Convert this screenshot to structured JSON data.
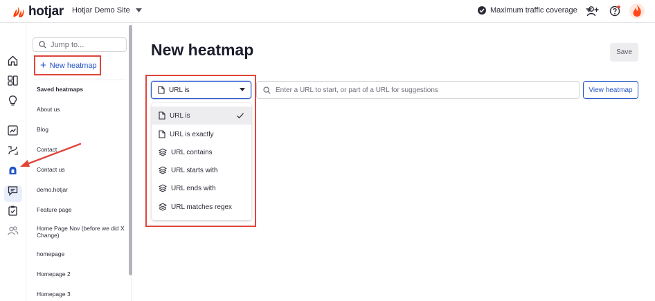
{
  "topbar": {
    "brand": "hotjar",
    "site_name": "Hotjar Demo Site",
    "traffic_label": "Maximum traffic coverage",
    "icons": [
      "hotjar-logo-icon",
      "chevron-down-icon",
      "check-circle-icon",
      "add-user-icon",
      "help-icon",
      "flame-avatar-icon"
    ]
  },
  "rail": {
    "icons": [
      "home-icon",
      "dashboards-icon",
      "lightbulb-icon",
      "trends-icon",
      "recordings-icon",
      "heatmaps-icon",
      "feedback-icon",
      "surveys-icon",
      "users-icon"
    ],
    "active": "heatmaps-icon"
  },
  "sidebar": {
    "search_placeholder": "Jump to...",
    "new_heatmap_label": "New heatmap",
    "saved_title": "Saved heatmaps",
    "items": [
      "About us",
      "Blog",
      "Contact",
      "Contact us",
      "demo.hotjar",
      "Feature page",
      "Home Page Nov (before we did X Change)",
      "homepage",
      "Homepage 2",
      "Homepage 3"
    ]
  },
  "main": {
    "title": "New heatmap",
    "save_label": "Save",
    "filter_selected": "URL is",
    "url_placeholder": "Enter a URL to start, or part of a URL for suggestions",
    "view_label": "View heatmap",
    "menu_items": [
      {
        "label": "URL is",
        "icon": "page-icon",
        "selected": true
      },
      {
        "label": "URL is exactly",
        "icon": "page-icon",
        "selected": false
      },
      {
        "label": "URL contains",
        "icon": "layers-icon",
        "selected": false
      },
      {
        "label": "URL starts with",
        "icon": "layers-icon",
        "selected": false
      },
      {
        "label": "URL ends with",
        "icon": "layers-icon",
        "selected": false
      },
      {
        "label": "URL matches regex",
        "icon": "layers-icon",
        "selected": false
      }
    ]
  },
  "colors": {
    "accent": "#2253c7",
    "annotation_red": "#e0453a",
    "brand_orange": "#ff3c00"
  }
}
